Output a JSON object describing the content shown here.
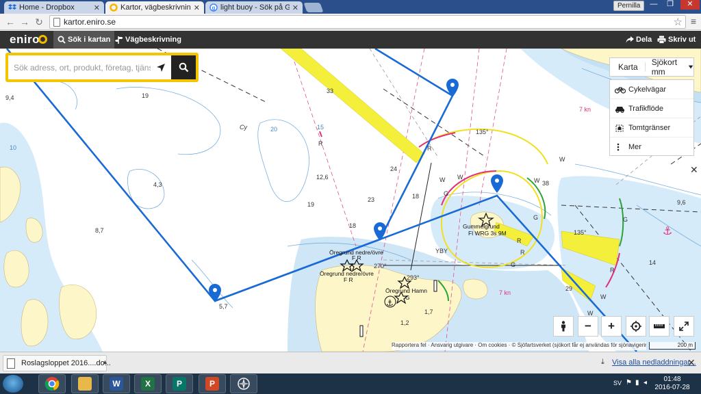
{
  "browser": {
    "tabs": [
      {
        "label": "Home - Dropbox",
        "icon": "dropbox-icon",
        "active": false
      },
      {
        "label": "Kartor, vägbeskrivningar, f",
        "icon": "eniro-icon",
        "active": true
      },
      {
        "label": "light buoy - Sök på Goog",
        "icon": "google-icon",
        "active": false
      }
    ],
    "profile_name": "Pernilla",
    "url": "kartor.eniro.se"
  },
  "header": {
    "logo": "eniro",
    "search_map_label": "Sök i kartan",
    "directions_label": "Vägbeskrivning",
    "share_label": "Dela",
    "print_label": "Skriv ut"
  },
  "search": {
    "placeholder": "Sök adress, ort, produkt, företag, tjänst"
  },
  "map_type": {
    "karta_label": "Karta",
    "sjokort_label": "Sjökort mm",
    "layers": [
      "Cykelvägar",
      "Trafikflöde",
      "Tomtgränser",
      "Mer"
    ]
  },
  "map": {
    "depth_labels": [
      "33",
      "19",
      "9,4",
      "Cy",
      "20",
      "15",
      "R",
      "4,3",
      "12,6",
      "19",
      "24",
      "23",
      "18",
      "18",
      "8,7",
      "5,7",
      "38",
      "9,6",
      "14",
      "29",
      "1,7",
      "1,2",
      "7 kn",
      "7 kn",
      "10",
      "W",
      "W",
      "W",
      "G",
      "G",
      "R",
      "R",
      "G",
      "W",
      "R",
      "W",
      "R",
      "W",
      "G",
      "135°",
      "135°",
      "270°",
      "293°",
      "YBY"
    ],
    "place_labels": {
      "gummelgrund": "Gummelgrund",
      "gummelgrund_light": "Fl WRG 3s 9M",
      "oregrund_upper": "Öregrund nedre/övre",
      "oregrund_upper_fr": "F R",
      "oregrund_lower": "Öregrund nedre/övre",
      "oregrund_lower_fr": "F R",
      "oregrund_hamn": "Öregrund Hamn",
      "hamn_g": "G"
    },
    "route_waypoints": 4,
    "attribution": "Rapportera fel · Ansvarig utgivare · Om cookies · © Sjöfartsverket (sjökort får ej användas för sjönavigering)",
    "scale": "200 m"
  },
  "downloads": {
    "file_name": "Roslagsloppet 2016....do...",
    "show_all": "Visa alla nedladdningar..."
  },
  "taskbar": {
    "language": "SV",
    "time": "01:48",
    "date": "2016-07-28"
  },
  "colors": {
    "route": "#1a6ad6",
    "land": "#fdf6c9",
    "shallow": "#cfe6f7",
    "sector_yellow": "#f4ef3a",
    "eniro_yellow": "#f5c400"
  }
}
